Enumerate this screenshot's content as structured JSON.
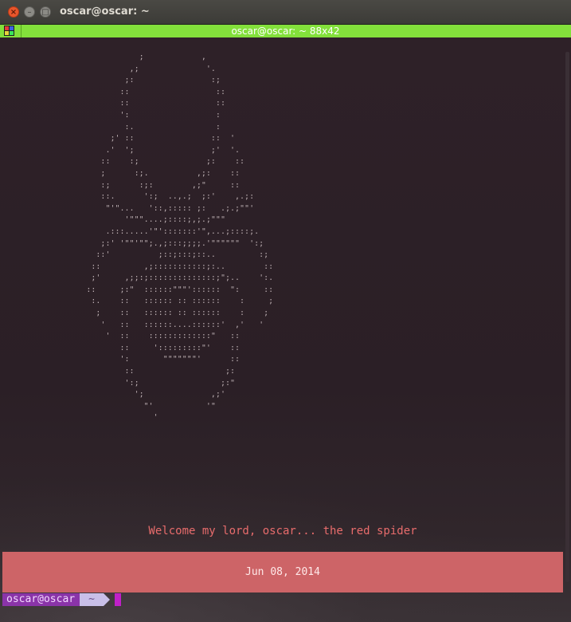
{
  "window": {
    "title": "oscar@oscar: ~",
    "buttons": {
      "close": "×",
      "minimize": "–",
      "maximize": "□"
    }
  },
  "terminal_header": {
    "title": "oscar@oscar: ~ 88x42",
    "icon": "terminal-menu-icon"
  },
  "content": {
    "ascii_art_lines": [
      "                             ;            ,",
      "                           ,;              '.",
      "                          ;:                :;",
      "                         ::                  ::",
      "                         ::                  ::",
      "                         ':                  :",
      "                          :.                 :",
      "                       ;' ::                ::  '",
      "                      .'  ';                ;'  '.",
      "                     ::    :;              ;:    ::",
      "                     ;      :;.          ,;:    ::",
      "                     :;      :;:        ,;\"     ::",
      "                     ::.      ':;  ..,.;  ;:'    ,.;:",
      "                      \"'\"...   '::,::::: ;:   .;.;\"\"'",
      "                          '\"\"\"....;::::;,;.;\"\"\"",
      "                      .:::.....'\"':::::::'\",...;::::;.",
      "                     ;:' '\"\"'\"\";.,;:::;;;;.'\"\"\"\"\"\"  ':;",
      "                    ::'          ;::;:::;::..         :;",
      "                   ::         ,;:::::::::::;:..        ::",
      "                   ;'     ,;;:;::::::::::::::;\";..    ':.",
      "                  ::     ;:\"  ::::::\"\"\"'::::::  \":     ::",
      "                   :.    ::   :::::: :: ::::::    :     ;",
      "                    ;    ::   :::::: :: ::::::    :    ;",
      "                     '   ::   ::::::....::::::'  ,'   '",
      "                      '  ::    :::::::::::::\"   ::",
      "                         ::     ':::::::::\"'    ::",
      "                         ':       \"\"\"\"\"\"\"'      ::",
      "                          ::                   ;:",
      "                          ':;                 ;:\"",
      "                            ';              ,;'",
      "                              \"'           '\"",
      "                                '"
    ],
    "welcome": "Welcome my lord, oscar... the red spider",
    "date": "Jun 08, 2014"
  },
  "prompt": {
    "user": "oscar@oscar",
    "dir": "~"
  },
  "colors": {
    "header_bar": "#83e03b",
    "welcome_text": "#e86c6c",
    "date_bar": "#cd6467",
    "prompt_user_bg": "#8a34a9",
    "prompt_dir_bg": "#c9bfe8",
    "cursor": "#c020c8"
  }
}
